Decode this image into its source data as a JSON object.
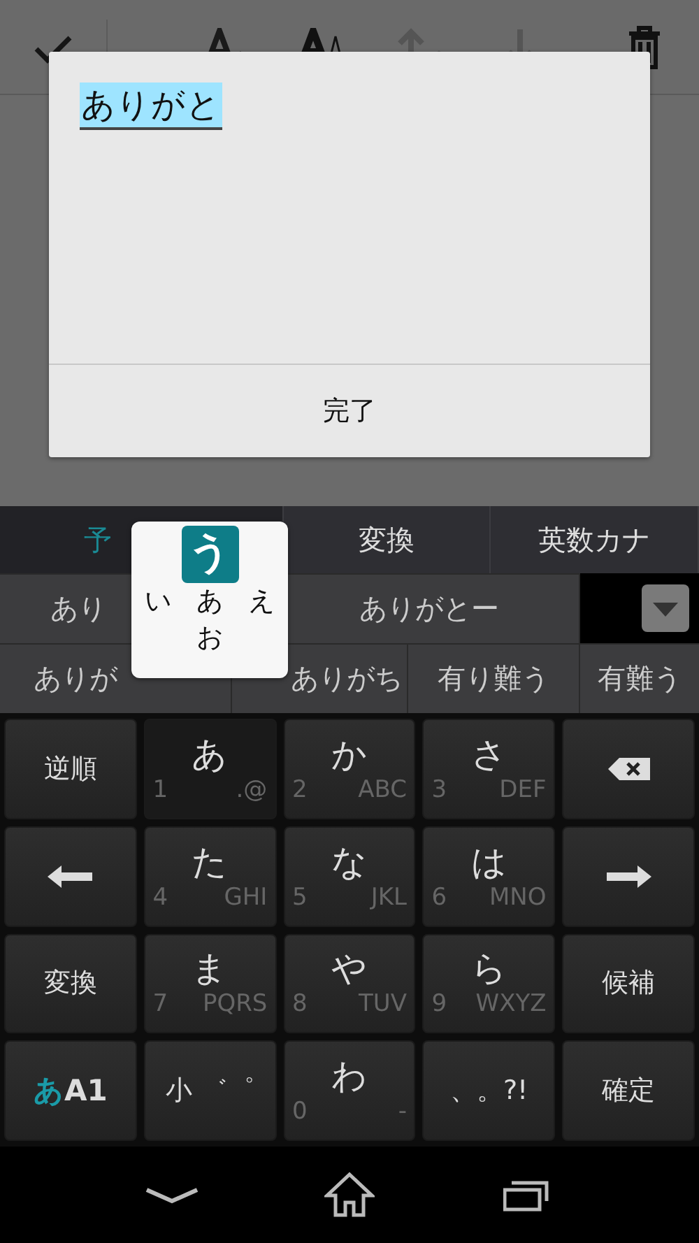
{
  "toolbar": {
    "icons": [
      {
        "kind": "check"
      },
      {
        "kind": "smaller"
      },
      {
        "kind": "larger"
      },
      {
        "kind": "up"
      },
      {
        "kind": "down"
      },
      {
        "kind": "trash"
      }
    ]
  },
  "dialog": {
    "field": {
      "value": "ありがと"
    },
    "button": "完了"
  },
  "ime": {
    "tabs": [
      {
        "label": "予",
        "selected": true
      },
      {
        "label": "変換",
        "selected": false
      },
      {
        "label": "英数カナ",
        "selected": false
      }
    ],
    "candidates_row_1": [
      "あり",
      "ありがとー"
    ],
    "candidates_row_2": [
      "ありが",
      "ありがち",
      "有り難う",
      "有難う"
    ],
    "flick_popup": {
      "center": "う",
      "left": "い",
      "middle": "あ",
      "right": "え",
      "bottom": "お"
    },
    "keys": [
      {
        "kind": "label",
        "label": "逆順"
      },
      {
        "kind": "kana",
        "label": "あ",
        "digit": "1",
        "letters": ".@",
        "pressed": true
      },
      {
        "kind": "kana",
        "label": "か",
        "digit": "2",
        "letters": "ABC",
        "pressed": false
      },
      {
        "kind": "kana",
        "label": "さ",
        "digit": "3",
        "letters": "DEF",
        "pressed": false
      },
      {
        "kind": "backspace"
      },
      {
        "kind": "left"
      },
      {
        "kind": "kana",
        "label": "た",
        "digit": "4",
        "letters": "GHI",
        "pressed": false
      },
      {
        "kind": "kana",
        "label": "な",
        "digit": "5",
        "letters": "JKL",
        "pressed": false
      },
      {
        "kind": "kana",
        "label": "は",
        "digit": "6",
        "letters": "MNO",
        "pressed": false
      },
      {
        "kind": "right"
      },
      {
        "kind": "label",
        "label": "変換"
      },
      {
        "kind": "kana",
        "label": "ま",
        "digit": "7",
        "letters": "PQRS",
        "pressed": false
      },
      {
        "kind": "kana",
        "label": "や",
        "digit": "8",
        "letters": "TUV",
        "pressed": false
      },
      {
        "kind": "kana",
        "label": "ら",
        "digit": "9",
        "letters": "WXYZ",
        "pressed": false
      },
      {
        "kind": "label",
        "label": "候補"
      },
      {
        "kind": "mode",
        "parts": [
          {
            "text": "あ",
            "selected": true
          },
          {
            "text": "A1",
            "selected": false
          }
        ]
      },
      {
        "kind": "label",
        "label": "小 ゛゜"
      },
      {
        "kind": "kana",
        "label": "わ",
        "digit": "0",
        "letters": "-",
        "pressed": false
      },
      {
        "kind": "label",
        "label": "、。?!"
      },
      {
        "kind": "label",
        "label": "確定"
      }
    ]
  },
  "nav": [
    {
      "kind": "back"
    },
    {
      "kind": "home"
    },
    {
      "kind": "recents"
    }
  ]
}
